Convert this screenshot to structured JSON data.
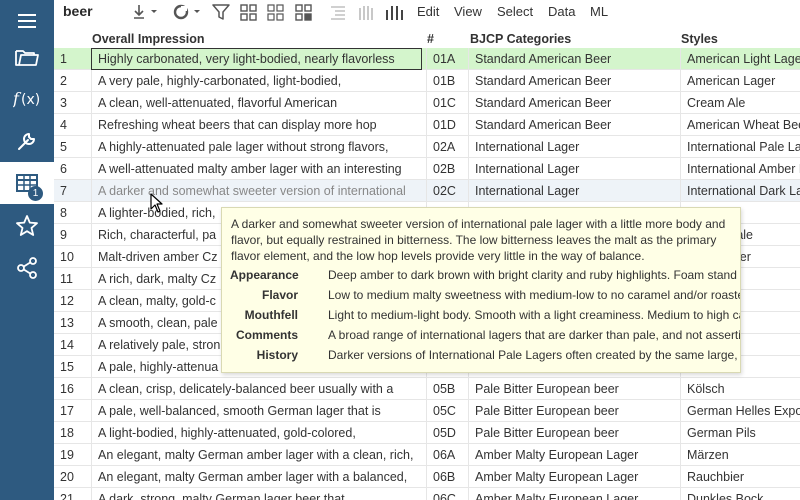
{
  "toolbar": {
    "title": "beer",
    "icons": [
      "download-icon",
      "refresh-icon",
      "filter-icon",
      "grid-view-icon",
      "grid-view-alt-icon",
      "grid-view-split-icon",
      "list-indent-icon",
      "columns-light-icon",
      "columns-icon"
    ],
    "menus": [
      "Edit",
      "View",
      "Select",
      "Data",
      "ML"
    ]
  },
  "sidebar": {
    "items": [
      {
        "name": "menu-icon"
      },
      {
        "name": "folder-icon"
      },
      {
        "name": "function-icon"
      },
      {
        "name": "wrench-icon"
      },
      {
        "name": "table-icon",
        "active": true,
        "badge": "1"
      },
      {
        "name": "star-icon"
      },
      {
        "name": "share-icon"
      }
    ]
  },
  "grid": {
    "columns": [
      "Overall Impression",
      "#",
      "BJCP Categories",
      "Styles"
    ],
    "rows": [
      [
        "1",
        "Highly carbonated, very light-bodied, nearly flavorless",
        "01A",
        "Standard American Beer",
        "American Light Lager"
      ],
      [
        "2",
        "A very pale, highly-carbonated, light-bodied,",
        "01B",
        "Standard American Beer",
        "American Lager"
      ],
      [
        "3",
        "A clean, well-attenuated, flavorful American",
        "01C",
        "Standard American Beer",
        "Cream Ale"
      ],
      [
        "4",
        "Refreshing wheat beers that can display more hop",
        "01D",
        "Standard American Beer",
        "American Wheat Beer"
      ],
      [
        "5",
        "A highly-attenuated pale lager without strong flavors,",
        "02A",
        "International Lager",
        "International Pale Lager"
      ],
      [
        "6",
        "A well-attenuated malty amber lager with an interesting",
        "02B",
        "International Lager",
        "International Amber Lager"
      ],
      [
        "7",
        "A darker and somewhat sweeter version of international",
        "02C",
        "International Lager",
        "International Dark Lager"
      ],
      [
        "8",
        "A lighter-bodied, rich,",
        "",
        "",
        "e Lager"
      ],
      [
        "9",
        "Rich, characterful, pa",
        "",
        "",
        "emium Pale"
      ],
      [
        "10",
        "Malt-driven amber Cz",
        "",
        "",
        "mber Lager"
      ],
      [
        "11",
        "A rich, dark, malty Cz",
        "",
        "",
        "rk Lager"
      ],
      [
        "12",
        "A clean, malty, gold-c",
        "",
        "",
        "elles"
      ],
      [
        "13",
        "A smooth, clean, pale",
        "",
        "",
        ""
      ],
      [
        "14",
        "A relatively pale, stron",
        "",
        "",
        "ck"
      ],
      [
        "15",
        "A pale, highly-attenua",
        "",
        "",
        "eichtbier"
      ],
      [
        "16",
        "A clean, crisp, delicately-balanced beer usually with a",
        "05B",
        "Pale Bitter European beer",
        "Kölsch"
      ],
      [
        "17",
        "A pale, well-balanced, smooth German lager that is",
        "05C",
        "Pale Bitter European beer",
        "German Helles Exportbier"
      ],
      [
        "18",
        "A light-bodied, highly-attenuated, gold-colored,",
        "05D",
        "Pale Bitter European beer",
        "German Pils"
      ],
      [
        "19",
        "An elegant, malty German amber lager with a clean, rich,",
        "06A",
        "Amber Malty European Lager",
        "Märzen"
      ],
      [
        "20",
        "An elegant, malty German amber lager with a balanced,",
        "06B",
        "Amber Malty European Lager",
        "Rauchbier"
      ],
      [
        "21",
        "A dark, strong, malty German lager beer that",
        "06C",
        "Amber Malty European Lager",
        "Dunkles Bock"
      ]
    ]
  },
  "tooltip": {
    "description": "A darker and somewhat sweeter version of international pale lager with a little more body and flavor, but equally restrained in bitterness. The low bitterness leaves the malt as the primary flavor element, and the low hop levels provide very little in the way of balance.",
    "fields": [
      {
        "key": "Appearance",
        "value": "Deep amber to dark brown with bright clarity and ruby highlights. Foam stand may not be long lasting"
      },
      {
        "key": "Flavor",
        "value": "Low to medium malty sweetness with medium-low to no caramel and/or roasted malt flavors"
      },
      {
        "key": "Mouthfell",
        "value": "Light to medium-light body. Smooth with a light creaminess. Medium to high carbonation"
      },
      {
        "key": "Comments",
        "value": "A broad range of international lagers that are darker than pale, and not assertively bitter"
      },
      {
        "key": "History",
        "value": "Darker versions of International Pale Lagers often created by the same large, industrial brewers"
      }
    ]
  },
  "colors": {
    "sidebar": "#2e5a80",
    "selected_row": "#d4f5cc",
    "tooltip_bg": "#ffffe6"
  }
}
